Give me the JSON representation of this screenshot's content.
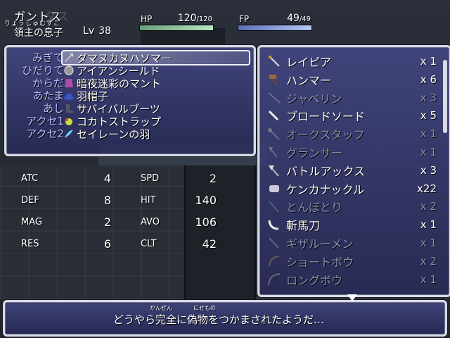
{
  "character": {
    "name": "ガントス",
    "ghost_text": "タス",
    "title_ruby": "りょうしゅむすこ",
    "title": "領主の息子",
    "level_label": "Lv",
    "level": "38",
    "hp_label": "HP",
    "hp": "120",
    "hp_max": "/120",
    "hp_fraction": 1.0,
    "fp_label": "FP",
    "fp": "49",
    "fp_max": "/49",
    "fp_fraction": 1.0
  },
  "equipment": {
    "slots": [
      "みぎて",
      "ひだりて",
      "からだ",
      "あたま",
      "あし",
      "アクセ1",
      "アクセ2"
    ],
    "items": [
      {
        "icon": "axe-icon",
        "name": "ダマヌカヌハソマー"
      },
      {
        "icon": "shield-icon",
        "name": "アイアンシールド"
      },
      {
        "icon": "cloak-icon",
        "name": "暗夜迷彩のマント"
      },
      {
        "icon": "hat-icon",
        "name": "羽帽子"
      },
      {
        "icon": "boots-icon",
        "name": "サバイバルブーツ"
      },
      {
        "icon": "strap-icon",
        "name": "コカトストラップ"
      },
      {
        "icon": "feather-icon",
        "name": "セイレーンの羽"
      }
    ],
    "selected_index": 0
  },
  "stats": [
    {
      "label": "ATC",
      "value": "4",
      "label2": "SPD",
      "value2": "2"
    },
    {
      "label": "DEF",
      "value": "8",
      "label2": "HIT",
      "value2": "140"
    },
    {
      "label": "MAG",
      "value": "2",
      "label2": "AVO",
      "value2": "106"
    },
    {
      "label": "RES",
      "value": "6",
      "label2": "CLT",
      "value2": "42"
    }
  ],
  "inventory": [
    {
      "icon": "rapier-icon",
      "name": "レイピア",
      "qty": "x 1",
      "enabled": true
    },
    {
      "icon": "hammer-icon",
      "name": "ハンマー",
      "qty": "x 6",
      "enabled": true
    },
    {
      "icon": "javelin-icon",
      "name": "ジャベリン",
      "qty": "x 3",
      "enabled": false
    },
    {
      "icon": "broadsword-icon",
      "name": "ブロードソード",
      "qty": "x 5",
      "enabled": true
    },
    {
      "icon": "staff-icon",
      "name": "オークスタッフ",
      "qty": "x 1",
      "enabled": false
    },
    {
      "icon": "glaive-icon",
      "name": "グランサー",
      "qty": "x 1",
      "enabled": false
    },
    {
      "icon": "battleaxe-icon",
      "name": "バトルアックス",
      "qty": "x 3",
      "enabled": true
    },
    {
      "icon": "knuckle-icon",
      "name": "ケンカナックル",
      "qty": "x22",
      "enabled": true
    },
    {
      "icon": "dragonfly-icon",
      "name": "とんぼとり",
      "qty": "x 2",
      "enabled": false
    },
    {
      "icon": "zanbato-icon",
      "name": "斬馬刀",
      "qty": "x 1",
      "enabled": true
    },
    {
      "icon": "giza-icon",
      "name": "ギザルーメン",
      "qty": "x 1",
      "enabled": false
    },
    {
      "icon": "shortbow-icon",
      "name": "ショートボウ",
      "qty": "x 2",
      "enabled": false
    },
    {
      "icon": "longbow-icon",
      "name": "ロングボウ",
      "qty": "x 1",
      "enabled": false
    }
  ],
  "message": {
    "ruby1": "かんぜん",
    "ruby2": "にせもの",
    "text": "どうやら完全に偽物をつかまされたようだ…"
  }
}
